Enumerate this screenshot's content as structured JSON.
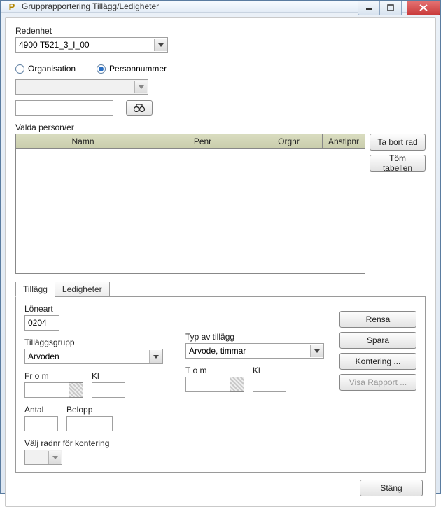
{
  "window": {
    "title": "Grupprapportering Tillägg/Ledigheter"
  },
  "redenhet": {
    "label": "Redenhet",
    "value": "4900  T521_3_I_00"
  },
  "lookup_mode": {
    "organisation_label": "Organisation",
    "personnummer_label": "Personnummer",
    "selected": "personnummer"
  },
  "selected_persons": {
    "label": "Valda person/er",
    "columns": [
      "Namn",
      "Penr",
      "Orgnr",
      "Anstlpnr"
    ],
    "rows": []
  },
  "side_buttons": {
    "remove_row": "Ta bort rad",
    "clear_table": "Töm tabellen"
  },
  "tabs": {
    "tillagg": "Tillägg",
    "ledigheter": "Ledigheter",
    "active": "tillagg"
  },
  "tillagg_panel": {
    "loneart_label": "Löneart",
    "loneart_value": "0204",
    "tillagsgrupp_label": "Tilläggsgrupp",
    "tillagsgrupp_value": "Arvoden",
    "typ_label": "Typ av tillägg",
    "typ_value": "Arvode, timmar",
    "from_label": "Fr o m",
    "tom_label": "T o m",
    "kl_label": "Kl",
    "antal_label": "Antal",
    "belopp_label": "Belopp",
    "valj_rad_label": "Välj radnr för kontering"
  },
  "action_buttons": {
    "rensa": "Rensa",
    "spara": "Spara",
    "kontering": "Kontering ...",
    "visa_rapport": "Visa Rapport ..."
  },
  "footer": {
    "stang": "Stäng"
  }
}
